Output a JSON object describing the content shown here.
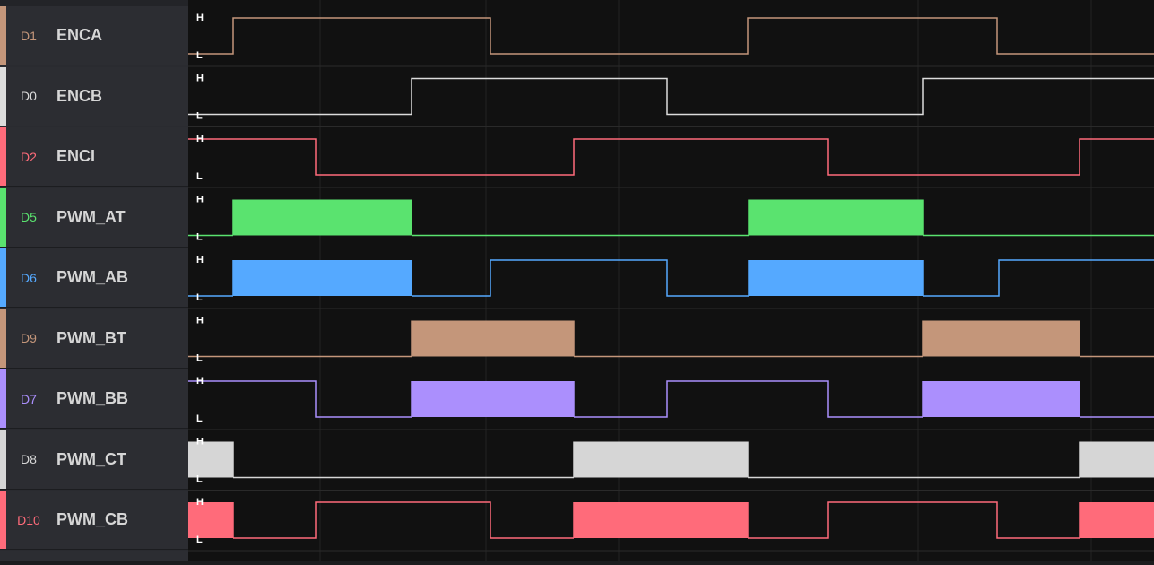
{
  "level_labels": {
    "high": "H",
    "low": "L"
  },
  "channels": [
    {
      "id": "D1",
      "name": "ENCA",
      "color": "#c4967a",
      "style": "line",
      "edges": [
        50,
        337,
        624,
        902
      ],
      "start_high": false
    },
    {
      "id": "D0",
      "name": "ENCB",
      "color": "#dcdcdc",
      "style": "line",
      "edges": [
        249,
        534,
        819
      ],
      "start_high": false
    },
    {
      "id": "D2",
      "name": "ENCI",
      "color": "#ff6b7a",
      "style": "line",
      "edges": [
        142,
        430,
        713,
        994
      ],
      "start_high": true
    },
    {
      "id": "D5",
      "name": "PWM_AT",
      "color": "#5ae36f",
      "style": "fill",
      "edges": [
        50,
        249,
        625,
        819
      ],
      "start_high": false
    },
    {
      "id": "D6",
      "name": "PWM_AB",
      "color": "#55a9ff",
      "style": "mix",
      "edges": [
        50,
        249,
        337,
        534,
        625,
        819,
        904
      ],
      "fill_segments": [
        [
          50,
          249
        ],
        [
          625,
          819
        ]
      ],
      "start_high": false
    },
    {
      "id": "D9",
      "name": "PWM_BT",
      "color": "#c4967a",
      "style": "fill",
      "edges": [
        249,
        430,
        819,
        994
      ],
      "start_high": false
    },
    {
      "id": "D7",
      "name": "PWM_BB",
      "color": "#ab8ffd",
      "style": "mix",
      "edges": [
        142,
        249,
        430,
        534,
        713,
        819,
        994
      ],
      "fill_segments": [
        [
          249,
          430
        ],
        [
          819,
          994
        ]
      ],
      "start_high": true
    },
    {
      "id": "D8",
      "name": "PWM_CT",
      "color": "#d6d6d6",
      "style": "fill",
      "edges": [
        50,
        430,
        624,
        994
      ],
      "start_high": true
    },
    {
      "id": "D10",
      "name": "PWM_CB",
      "color": "#ff6b7a",
      "style": "mix",
      "edges": [
        50,
        142,
        337,
        430,
        624,
        713,
        902,
        994
      ],
      "fill_segments": [
        [
          0,
          50
        ],
        [
          430,
          624
        ],
        [
          994,
          1077
        ]
      ],
      "start_high": true
    }
  ]
}
